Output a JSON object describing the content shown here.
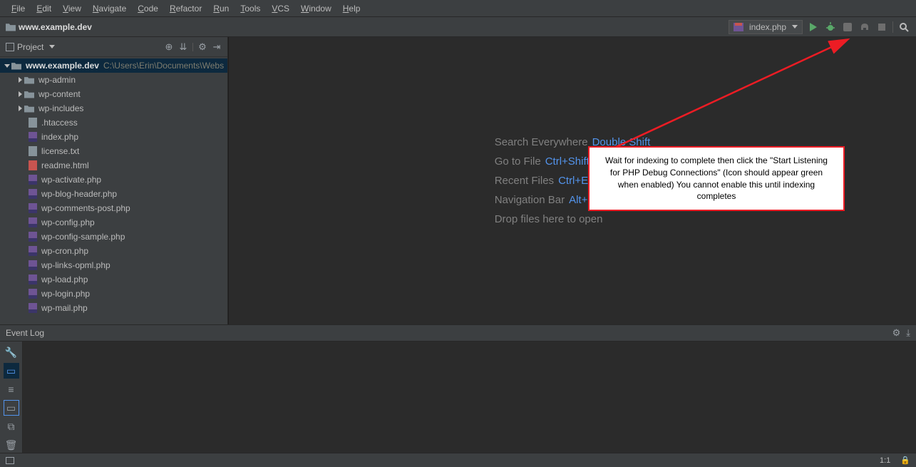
{
  "menu": [
    "File",
    "Edit",
    "View",
    "Navigate",
    "Code",
    "Refactor",
    "Run",
    "Tools",
    "VCS",
    "Window",
    "Help"
  ],
  "breadcrumb": {
    "project": "www.example.dev"
  },
  "runconfig": {
    "label": "index.php"
  },
  "project_panel": {
    "title": "Project",
    "root": {
      "name": "www.example.dev",
      "path": "C:\\Users\\Erin\\Documents\\Webs"
    },
    "folders": [
      "wp-admin",
      "wp-content",
      "wp-includes"
    ],
    "files": [
      {
        "name": ".htaccess",
        "type": "txt"
      },
      {
        "name": "index.php",
        "type": "php"
      },
      {
        "name": "license.txt",
        "type": "txt"
      },
      {
        "name": "readme.html",
        "type": "html"
      },
      {
        "name": "wp-activate.php",
        "type": "php"
      },
      {
        "name": "wp-blog-header.php",
        "type": "php"
      },
      {
        "name": "wp-comments-post.php",
        "type": "php"
      },
      {
        "name": "wp-config.php",
        "type": "php"
      },
      {
        "name": "wp-config-sample.php",
        "type": "php"
      },
      {
        "name": "wp-cron.php",
        "type": "php"
      },
      {
        "name": "wp-links-opml.php",
        "type": "php"
      },
      {
        "name": "wp-load.php",
        "type": "php"
      },
      {
        "name": "wp-login.php",
        "type": "php"
      },
      {
        "name": "wp-mail.php",
        "type": "php"
      }
    ]
  },
  "welcome": {
    "r1a": "Search Everywhere",
    "r1b": "Double Shift",
    "r2a": "Go to File",
    "r2b": "Ctrl+Shift+N",
    "r3a": "Recent Files",
    "r3b": "Ctrl+E",
    "r4a": "Navigation Bar",
    "r4b": "Alt+Home",
    "r5": "Drop files here to open"
  },
  "eventlog": {
    "title": "Event Log"
  },
  "status": {
    "pos": "1:1",
    "lock": "🔒"
  },
  "callout": "Wait for indexing to complete then click the \"Start Listening for PHP Debug Connections\" (Icon should appear green when enabled) You cannot enable this until indexing completes"
}
